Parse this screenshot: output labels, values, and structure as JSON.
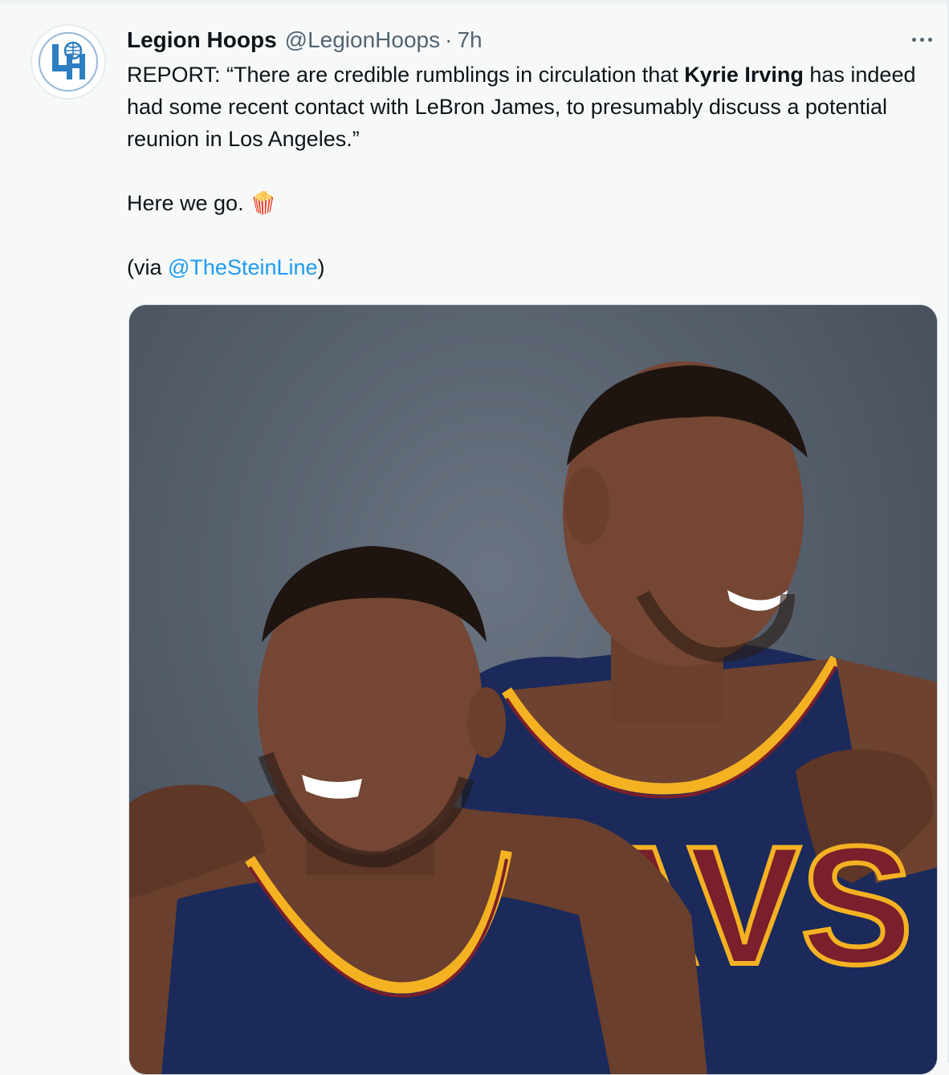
{
  "tweet": {
    "author_name": "Legion Hoops",
    "author_handle": "@LegionHoops",
    "separator": "·",
    "timestamp": "7h",
    "avatar_initials": "LH",
    "text": {
      "line1_before": "REPORT: “There are credible rumblings in circulation that ",
      "line1_bold": "Kyrie Irving",
      "line1_after": " has indeed had some recent contact with LeBron James, to presumably discuss a potential reunion in Los Angeles.”",
      "line2": "Here we go.",
      "line2_emoji": "🍿",
      "line3_before": "(via ",
      "line3_mention": "@TheSteinLine",
      "line3_after": ")"
    },
    "media": {
      "jersey_lettering": "AVS"
    }
  },
  "colors": {
    "mention": "#1d9bf0",
    "secondary_text": "#536471",
    "jersey_navy": "#1b2a5b",
    "jersey_trim_gold": "#f4b223",
    "jersey_trim_wine": "#7a1f2b"
  }
}
